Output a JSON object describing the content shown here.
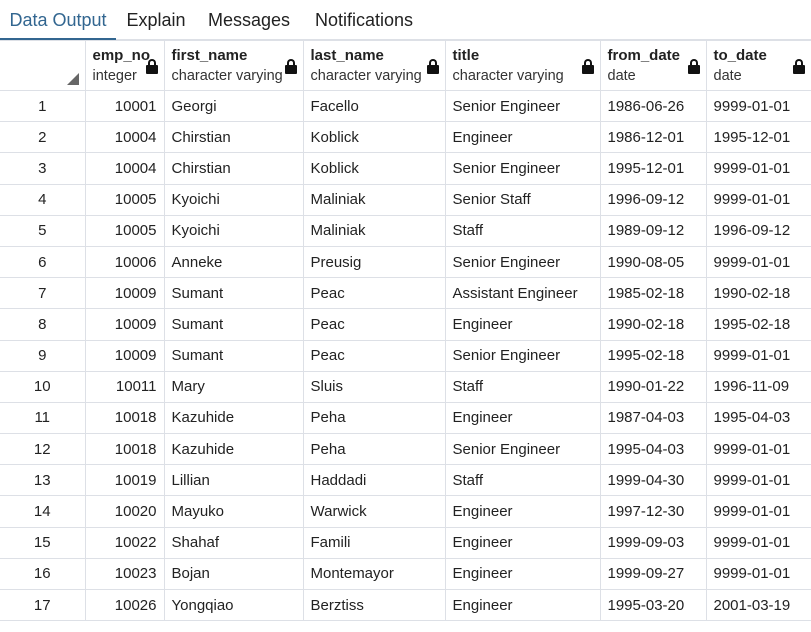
{
  "tabs": [
    {
      "label": "Data Output",
      "active": true
    },
    {
      "label": "Explain",
      "active": false
    },
    {
      "label": "Messages",
      "active": false
    },
    {
      "label": "Notifications",
      "active": false
    }
  ],
  "columns": [
    {
      "name": "emp_no",
      "type": "integer"
    },
    {
      "name": "first_name",
      "type": "character varying"
    },
    {
      "name": "last_name",
      "type": "character varying"
    },
    {
      "name": "title",
      "type": "character varying"
    },
    {
      "name": "from_date",
      "type": "date"
    },
    {
      "name": "to_date",
      "type": "date"
    }
  ],
  "rows": [
    {
      "n": "1",
      "emp_no": "10001",
      "first_name": "Georgi",
      "last_name": "Facello",
      "title": "Senior Engineer",
      "from_date": "1986-06-26",
      "to_date": "9999-01-01"
    },
    {
      "n": "2",
      "emp_no": "10004",
      "first_name": "Chirstian",
      "last_name": "Koblick",
      "title": "Engineer",
      "from_date": "1986-12-01",
      "to_date": "1995-12-01"
    },
    {
      "n": "3",
      "emp_no": "10004",
      "first_name": "Chirstian",
      "last_name": "Koblick",
      "title": "Senior Engineer",
      "from_date": "1995-12-01",
      "to_date": "9999-01-01"
    },
    {
      "n": "4",
      "emp_no": "10005",
      "first_name": "Kyoichi",
      "last_name": "Maliniak",
      "title": "Senior Staff",
      "from_date": "1996-09-12",
      "to_date": "9999-01-01"
    },
    {
      "n": "5",
      "emp_no": "10005",
      "first_name": "Kyoichi",
      "last_name": "Maliniak",
      "title": "Staff",
      "from_date": "1989-09-12",
      "to_date": "1996-09-12"
    },
    {
      "n": "6",
      "emp_no": "10006",
      "first_name": "Anneke",
      "last_name": "Preusig",
      "title": "Senior Engineer",
      "from_date": "1990-08-05",
      "to_date": "9999-01-01"
    },
    {
      "n": "7",
      "emp_no": "10009",
      "first_name": "Sumant",
      "last_name": "Peac",
      "title": "Assistant Engineer",
      "from_date": "1985-02-18",
      "to_date": "1990-02-18"
    },
    {
      "n": "8",
      "emp_no": "10009",
      "first_name": "Sumant",
      "last_name": "Peac",
      "title": "Engineer",
      "from_date": "1990-02-18",
      "to_date": "1995-02-18"
    },
    {
      "n": "9",
      "emp_no": "10009",
      "first_name": "Sumant",
      "last_name": "Peac",
      "title": "Senior Engineer",
      "from_date": "1995-02-18",
      "to_date": "9999-01-01"
    },
    {
      "n": "10",
      "emp_no": "10011",
      "first_name": "Mary",
      "last_name": "Sluis",
      "title": "Staff",
      "from_date": "1990-01-22",
      "to_date": "1996-11-09"
    },
    {
      "n": "11",
      "emp_no": "10018",
      "first_name": "Kazuhide",
      "last_name": "Peha",
      "title": "Engineer",
      "from_date": "1987-04-03",
      "to_date": "1995-04-03"
    },
    {
      "n": "12",
      "emp_no": "10018",
      "first_name": "Kazuhide",
      "last_name": "Peha",
      "title": "Senior Engineer",
      "from_date": "1995-04-03",
      "to_date": "9999-01-01"
    },
    {
      "n": "13",
      "emp_no": "10019",
      "first_name": "Lillian",
      "last_name": "Haddadi",
      "title": "Staff",
      "from_date": "1999-04-30",
      "to_date": "9999-01-01"
    },
    {
      "n": "14",
      "emp_no": "10020",
      "first_name": "Mayuko",
      "last_name": "Warwick",
      "title": "Engineer",
      "from_date": "1997-12-30",
      "to_date": "9999-01-01"
    },
    {
      "n": "15",
      "emp_no": "10022",
      "first_name": "Shahaf",
      "last_name": "Famili",
      "title": "Engineer",
      "from_date": "1999-09-03",
      "to_date": "9999-01-01"
    },
    {
      "n": "16",
      "emp_no": "10023",
      "first_name": "Bojan",
      "last_name": "Montemayor",
      "title": "Engineer",
      "from_date": "1999-09-27",
      "to_date": "9999-01-01"
    },
    {
      "n": "17",
      "emp_no": "10026",
      "first_name": "Yongqiao",
      "last_name": "Berztiss",
      "title": "Engineer",
      "from_date": "1995-03-20",
      "to_date": "2001-03-19"
    }
  ]
}
